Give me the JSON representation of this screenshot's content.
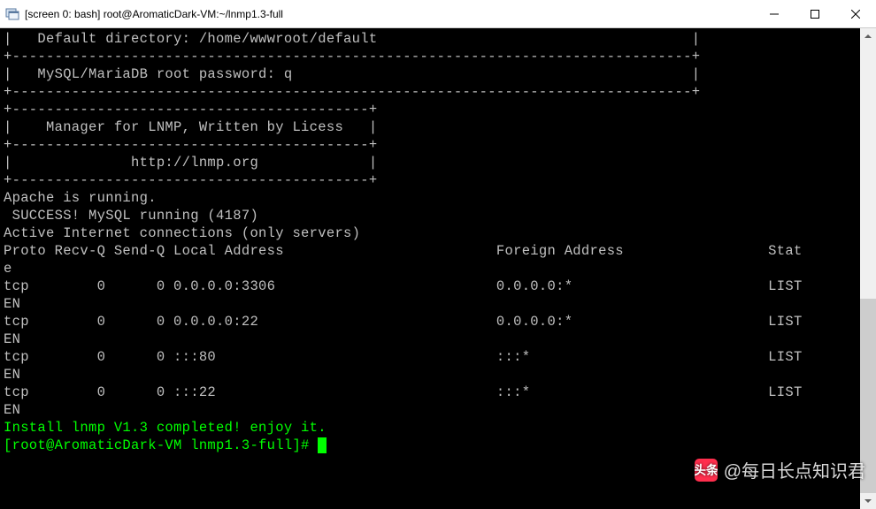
{
  "window": {
    "title": "[screen 0: bash] root@AromaticDark-VM:~/lnmp1.3-full"
  },
  "terminal": {
    "box1": {
      "line1": "|   Default directory: /home/wwwroot/default                                     |",
      "sep1": "+--------------------------------------------------------------------------------+",
      "line2": "|   MySQL/MariaDB root password: q                                               |",
      "sep2": "+--------------------------------------------------------------------------------+"
    },
    "box2": {
      "sep1": "+------------------------------------------+",
      "line1": "|    Manager for LNMP, Written by Licess   |",
      "sep2": "+------------------------------------------+",
      "line2": "|              http://lnmp.org             |",
      "sep3": "+------------------------------------------+"
    },
    "status": {
      "apache": "Apache is running.",
      "mysql": " SUCCESS! MySQL running (4187)"
    },
    "netstat": {
      "header1": "Active Internet connections (only servers)",
      "header2": "Proto Recv-Q Send-Q Local Address           Foreign Address         State",
      "rows": [
        {
          "text": "tcp        0      0 0.0.0.0:3306            0.0.0.0:*               LISTEN"
        },
        {
          "text": "tcp        0      0 0.0.0.0:22              0.0.0.0:*               LISTEN"
        },
        {
          "text": "tcp        0      0 :::80                   :::*                    LISTEN"
        },
        {
          "text": "tcp        0      0 :::22                   :::*                    LISTEN"
        }
      ]
    },
    "install_msg": "Install lnmp V1.3 completed! enjoy it.",
    "prompt": "[root@AromaticDark-VM lnmp1.3-full]# "
  },
  "watermark": {
    "prefix": "头条",
    "text": "@每日长点知识君"
  }
}
